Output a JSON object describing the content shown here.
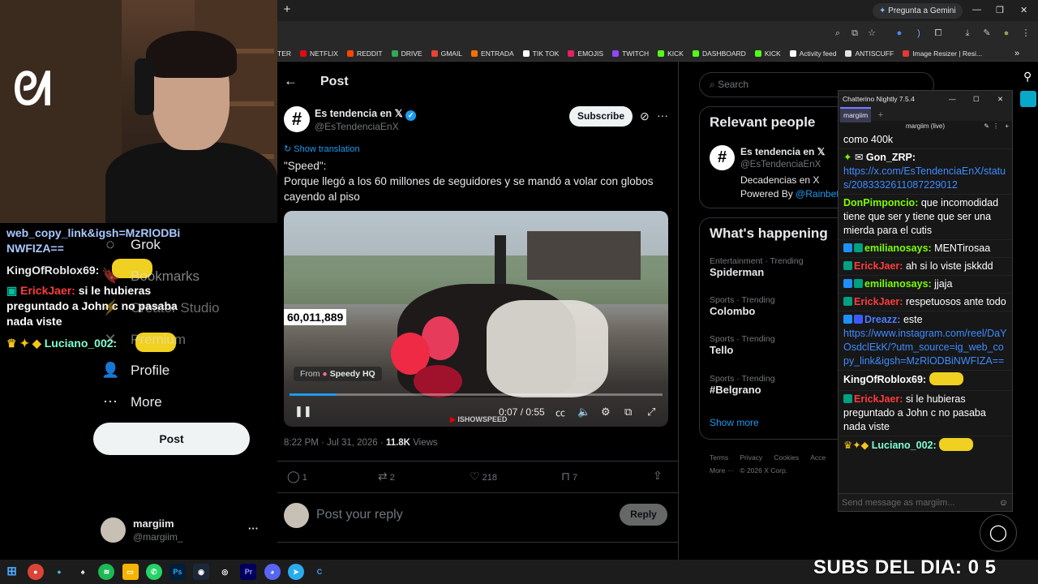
{
  "browser": {
    "new_tab": "+",
    "gemini_button": "Pregunta a Gemini",
    "window_controls": [
      "—",
      "❐",
      "✕"
    ],
    "bookmarks": [
      {
        "label": "TER",
        "color": ""
      },
      {
        "label": "NETFLIX",
        "color": "#e50914"
      },
      {
        "label": "REDDIT",
        "color": "#ff4500"
      },
      {
        "label": "DRIVE",
        "color": "#34a853"
      },
      {
        "label": "GMAIL",
        "color": "#ea4335"
      },
      {
        "label": "ENTRADA",
        "color": "#ff6d00"
      },
      {
        "label": "TIK TOK",
        "color": "#ffffff"
      },
      {
        "label": "EMOJIS",
        "color": "#e91e63"
      },
      {
        "label": "TWITCH",
        "color": "#9146ff"
      },
      {
        "label": "KICK",
        "color": "#53fc18"
      },
      {
        "label": "DASHBOARD",
        "color": "#53fc18"
      },
      {
        "label": "KICK",
        "color": "#53fc18"
      },
      {
        "label": "Activity feed",
        "color": "#ffffff"
      },
      {
        "label": "ANTISCUFF",
        "color": "#e3e3e3"
      },
      {
        "label": "Image Resizer | Resi...",
        "color": "#e53935"
      }
    ],
    "bookmarks_more": "»"
  },
  "stream_overlay": {
    "lines": [
      {
        "text": "web_copy_link&igsh=MzRlODBi",
        "color": "#a9c8ff"
      },
      {
        "text": "NWFIZA==",
        "color": "#a9c8ff"
      },
      {
        "text": "KingOfRoblox69:",
        "color": "#e7e9ea"
      },
      {
        "text": "ErickJaer:",
        "color": "#ff3b3b"
      },
      {
        "text": "si le hubieras",
        "color": "#ffffff"
      },
      {
        "text": "preguntado a John c no pasaba",
        "color": "#ffffff"
      },
      {
        "text": "nada viste",
        "color": "#ffffff"
      },
      {
        "text": "Luciano_002:",
        "color": "#7fffd4"
      }
    ]
  },
  "sidebar": {
    "items": [
      {
        "label": "Grok",
        "icon": "grok-icon",
        "glyph": "◌"
      },
      {
        "label": "Bookmarks",
        "icon": "bookmark-icon",
        "glyph": "🔖"
      },
      {
        "label": "Creator Studio",
        "icon": "creator-studio-icon",
        "glyph": "⚡"
      },
      {
        "label": "Premium",
        "icon": "premium-icon",
        "glyph": "✕"
      },
      {
        "label": "Profile",
        "icon": "profile-icon",
        "glyph": "👤"
      },
      {
        "label": "More",
        "icon": "more-icon",
        "glyph": "⋯"
      }
    ],
    "post_button": "Post",
    "account": {
      "name": "margiim",
      "handle": "@margiim_",
      "menu": "···"
    }
  },
  "post": {
    "header_title": "Post",
    "author": {
      "name": "Es tendencia en 𝕏",
      "handle": "@EsTendenciaEnX"
    },
    "subscribe": "Subscribe",
    "show_translation": "Show translation",
    "text_line1": "\"Speed\":",
    "text_line2": "Porque llegó a los 60 millones de seguidores y se mandó a volar con globos",
    "text_line3": "cayendo al piso",
    "video": {
      "counter": "60,011,889",
      "from_label": "From",
      "from_source": "Speedy HQ",
      "time": "0:07 / 0:55",
      "progress": 0.127,
      "watermark": "ISHOWSPEED"
    },
    "meta_time": "8:22 PM · Jul 31, 2026 ·",
    "views_count": "11.8K",
    "views_label": "Views",
    "actions": {
      "replies": "1",
      "reposts": "2",
      "likes": "218",
      "bookmarks": "7"
    },
    "reply_placeholder": "Post your reply",
    "reply_button": "Reply"
  },
  "right": {
    "search_placeholder": "Search",
    "relevant_title": "Relevant people",
    "relevant_name": "Es tendencia en 𝕏",
    "relevant_handle": "@EsTendenciaEnX",
    "relevant_bio1": "Decadencias en X",
    "relevant_bio2": "Powered By",
    "relevant_bio_link": "@Rainbet",
    "happening_title": "What's happening",
    "trends": [
      {
        "cat": "Entertainment · Trending",
        "name": "Spiderman"
      },
      {
        "cat": "Sports · Trending",
        "name": "Colombo"
      },
      {
        "cat": "Sports · Trending",
        "name": "Tello"
      },
      {
        "cat": "Sports · Trending",
        "name": "#Belgrano"
      }
    ],
    "show_more": "Show more",
    "footer1": [
      "Terms",
      "Privacy",
      "Cookies",
      "Acce"
    ],
    "footer2": [
      "More ···",
      "© 2026 X Corp."
    ]
  },
  "chatterino": {
    "title": "Chatterino Nightly 7.5.4",
    "tab": "margiim",
    "add_tab": "+",
    "channel_header": "margiim (live)",
    "messages": [
      {
        "type": "text",
        "text": "como 400k"
      },
      {
        "type": "user",
        "name": "Gon_ZRP:",
        "color": "#ffffff"
      },
      {
        "type": "link",
        "text": "https://x.com/EsTendenciaEnX/status/2083332611087229012"
      },
      {
        "type": "user",
        "name": "DonPimponcio:",
        "color": "#7cfc00",
        "text": "que incomodidad tiene que ser y tiene que ser una mierda para el cutis"
      },
      {
        "type": "user",
        "name": "emilianosays:",
        "color": "#7cfc00",
        "text": "MENTirosaa"
      },
      {
        "type": "user",
        "name": "ErickJaer:",
        "color": "#ff3b3b",
        "text": "ah si lo viste jskkdd"
      },
      {
        "type": "user",
        "name": "emilianosays:",
        "color": "#7cfc00",
        "text": "jjaja"
      },
      {
        "type": "user",
        "name": "ErickJaer:",
        "color": "#ff3b3b",
        "text": "respetuosos ante todo"
      },
      {
        "type": "user",
        "name": "Dreazz:",
        "color": "#4a7cff",
        "text": "este"
      },
      {
        "type": "link",
        "text": "https://www.instagram.com/reel/DaYOsdclEkK/?utm_source=ig_web_copy_link&igsh=MzRlODBiNWFIZA=="
      },
      {
        "type": "user",
        "name": "KingOfRoblox69:",
        "color": "#ffffff"
      },
      {
        "type": "user",
        "name": "ErickJaer:",
        "color": "#ff3b3b",
        "text": "si le hubieras preguntado a John c no pasaba nada viste"
      },
      {
        "type": "user",
        "name": "Luciano_002:",
        "color": "#7fffd4"
      }
    ],
    "input_placeholder": "Send message as margiim..."
  },
  "subs_overlay": "SUBS DEL DIA: 0 5"
}
